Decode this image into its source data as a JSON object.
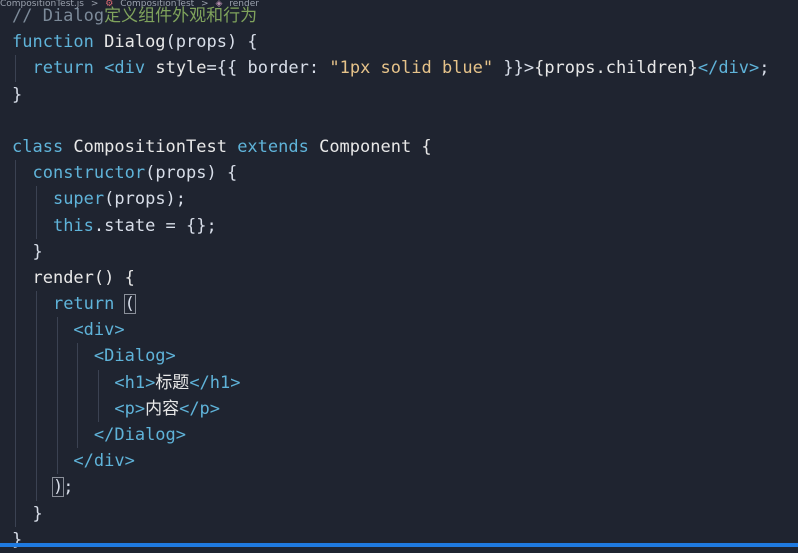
{
  "breadcrumb": {
    "file": "CompositionTest.js",
    "component": "CompositionTest",
    "method": "render",
    "separator": ">"
  },
  "code": {
    "l1_comment": "// Dialog",
    "l1_comment_cn": "定义组件外观和行为",
    "l2_kw": "function",
    "l2_name": " Dialog",
    "l2_rest": "(props) {",
    "l3_return": "return",
    "l3_tag_open": "<div",
    "l3_attr": " style",
    "l3_eq": "={{ border: ",
    "l3_str": "\"1px solid blue\"",
    "l3_close": " }}>",
    "l3_children": "{props.children}",
    "l3_tag_close": "</div>",
    "l3_semi": ";",
    "l4": "}",
    "l6_kw": "class",
    "l6_name": " CompositionTest ",
    "l6_extends": "extends",
    "l6_rest": " Component {",
    "l7_kw": "constructor",
    "l7_rest": "(props) {",
    "l8_kw": "super",
    "l8_rest": "(props);",
    "l9_kw": "this",
    "l9_rest": ".state = {};",
    "l10": "}",
    "l11": "render() {",
    "l12_kw": "return",
    "l12_paren": "(",
    "l13": "<div>",
    "l14": "<Dialog>",
    "l15_open": "<h1>",
    "l15_text": "标题",
    "l15_close": "</h1>",
    "l16_open": "<p>",
    "l16_text": "内容",
    "l16_close": "</p>",
    "l17": "</Dialog>",
    "l18": "</div>",
    "l19_paren": ")",
    "l19_semi": ";",
    "l20": "}",
    "l21": "}"
  },
  "colors": {
    "background": "#1f2430",
    "keyword": "#5fb3d9",
    "string": "#e6c38a",
    "comment": "#7c8a99",
    "statusbar": "#1f7ae0"
  }
}
